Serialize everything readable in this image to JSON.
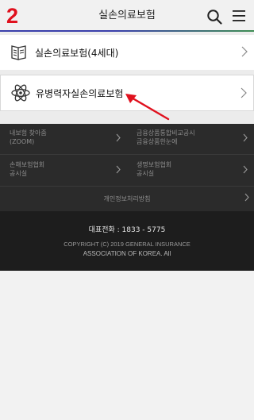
{
  "header": {
    "step_number": "2",
    "title": "실손의료보험",
    "accent_colors": [
      "#3a3faa",
      "#3f8e54"
    ]
  },
  "menu_items": [
    {
      "label": "실손의료보험(4세대)",
      "icon": "insurance-document-icon"
    },
    {
      "label": "유병력자실손의료보험",
      "icon": "atom-icon"
    }
  ],
  "footer": {
    "links": [
      {
        "label": "내보험 찾아줌\n(ZOOM)"
      },
      {
        "label": "금융상품통합비교공시\n금융상품한눈에"
      },
      {
        "label": "손해보험협회\n공시실"
      },
      {
        "label": "생명보험협회\n공시실"
      }
    ],
    "privacy": "개인정보처리방침",
    "phone": "대표전화 : 1833 - 5775",
    "copyright_line1": "COPYRIGHT (C) 2019 GENERAL INSURANCE",
    "copyright_line2": "ASSOCIATION OF KOREA. All"
  },
  "annotation": {
    "arrow_color": "#e0111e"
  }
}
